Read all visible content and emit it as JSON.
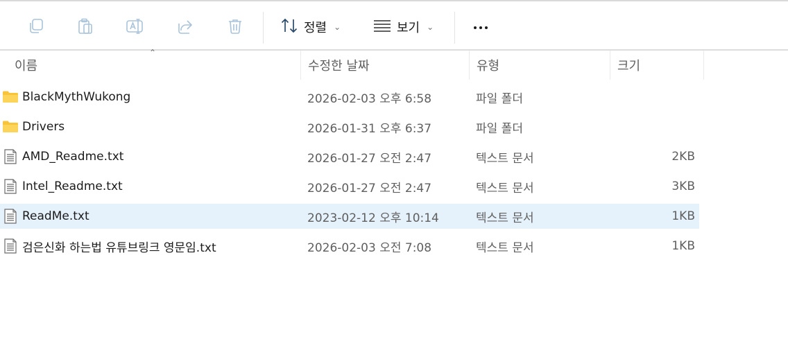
{
  "toolbar": {
    "sort_label": "정렬",
    "view_label": "보기",
    "icons": [
      "copy-icon",
      "paste-icon",
      "rename-icon",
      "share-icon",
      "delete-icon",
      "sort-icon",
      "view-icon",
      "more-icon"
    ]
  },
  "header": {
    "name": "이름",
    "date": "수정한 날짜",
    "type": "유형",
    "size": "크기"
  },
  "files": [
    {
      "name": "BlackMythWukong",
      "date": "2026-02-03 오후 6:58",
      "type": "파일 폴더",
      "size": "",
      "kind": "folder"
    },
    {
      "name": "Drivers",
      "date": "2026-01-31 오후 6:37",
      "type": "파일 폴더",
      "size": "",
      "kind": "folder"
    },
    {
      "name": "AMD_Readme.txt",
      "date": "2026-01-27 오전 2:47",
      "type": "텍스트 문서",
      "size": "2KB",
      "kind": "text"
    },
    {
      "name": "Intel_Readme.txt",
      "date": "2026-01-27 오전 2:47",
      "type": "텍스트 문서",
      "size": "3KB",
      "kind": "text"
    },
    {
      "name": "ReadMe.txt",
      "date": "2023-02-12 오후 10:14",
      "type": "텍스트 문서",
      "size": "1KB",
      "kind": "text",
      "selected": true
    },
    {
      "name": "검은신화 하는법 유튜브링크 영문임.txt",
      "date": "2026-02-03 오전 7:08",
      "type": "텍스트 문서",
      "size": "1KB",
      "kind": "text"
    }
  ],
  "colors": {
    "selected_row": "#e5f1fb",
    "folder": "#f8c53a",
    "icon_disabled": "#9bb8d3"
  }
}
